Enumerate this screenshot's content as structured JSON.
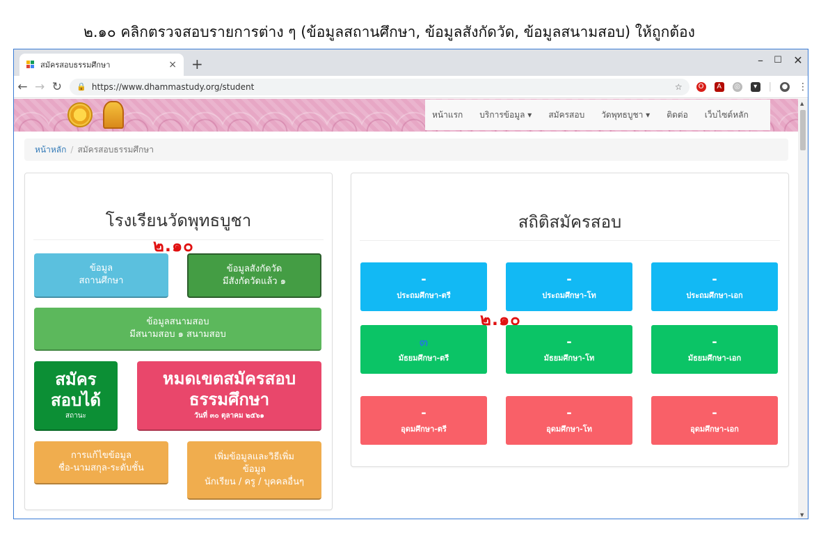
{
  "caption": "๒.๑๐ คลิกตรวจสอบรายการต่าง ๆ (ข้อมูลสถานศึกษา, ข้อมูลสังกัดวัด, ข้อมูลสนามสอบ) ให้ถูกต้อง",
  "browser": {
    "tab_title": "สมัครสอบธรรมศึกษา",
    "tab_close": "×",
    "new_tab": "+",
    "url": "https://www.dhammastudy.org/student",
    "win_min": "–",
    "win_max": "☐",
    "win_close": "✕"
  },
  "nav": {
    "items": [
      {
        "label": "หน้าแรก"
      },
      {
        "label": "บริการข้อมูล ▾"
      },
      {
        "label": "สมัครสอบ"
      },
      {
        "label": "วัดพุทธบูชา ▾"
      },
      {
        "label": "ติดต่อ"
      },
      {
        "label": "เว็บไซต์หลัก"
      }
    ]
  },
  "breadcrumb": {
    "home": "หน้าหลัก",
    "separator": "/",
    "current": "สมัครสอบธรรมศึกษา"
  },
  "left_panel": {
    "title": "โรงเรียนวัดพุทธบูชา",
    "annotation": "๒.๑๐",
    "btn_school_l1": "ข้อมูล",
    "btn_school_l2": "สถานศึกษา",
    "btn_temple_l1": "ข้อมูลสังกัดวัด",
    "btn_temple_l2": "มีสังกัดวัดแล้ว ๑",
    "btn_venue_l1": "ข้อมูลสนามสอบ",
    "btn_venue_l2": "มีสนามสอบ ๑ สนามสอบ",
    "status_l1": "สมัคร",
    "status_l2": "สอบได้",
    "status_sub": "สถานะ",
    "deadline_l1": "หมดเขตสมัครสอบ",
    "deadline_l2": "ธรรมศึกษา",
    "deadline_sub": "วันที่ ๓๐ ตุลาคม ๒๕๖๑",
    "edit_l1": "การแก้ไขข้อมูล",
    "edit_l2": "ชื่อ-นามสกุล-ระดับชั้น",
    "add_l1": "เพิ่มข้อมูลและวิธีเพิ่ม",
    "add_l2": "ข้อมูล",
    "add_l3": "นักเรียน / ครู / บุคคลอื่นๆ"
  },
  "right_panel": {
    "title": "สถิติสมัครสอบ",
    "annotation": "๒.๑๐",
    "stats": [
      {
        "value": "-",
        "label": "ประถมศึกษา-ตรี"
      },
      {
        "value": "-",
        "label": "ประถมศึกษา-โท"
      },
      {
        "value": "-",
        "label": "ประถมศึกษา-เอก"
      },
      {
        "value": "๓",
        "label": "มัธยมศึกษา-ตรี"
      },
      {
        "value": "-",
        "label": "มัธยมศึกษา-โท"
      },
      {
        "value": "-",
        "label": "มัธยมศึกษา-เอก"
      },
      {
        "value": "-",
        "label": "อุดมศึกษา-ตรี"
      },
      {
        "value": "-",
        "label": "อุดมศึกษา-โท"
      },
      {
        "value": "-",
        "label": "อุดมศึกษา-เอก"
      }
    ]
  },
  "colors": {
    "blue_btn": "#5bc0de",
    "green_dark": "#449d44",
    "green": "#5cb85c",
    "red": "#e9476b",
    "orange": "#f0ad4e",
    "stat_blue": "#12b9f4",
    "stat_green": "#0bc466",
    "stat_red": "#f96068"
  }
}
